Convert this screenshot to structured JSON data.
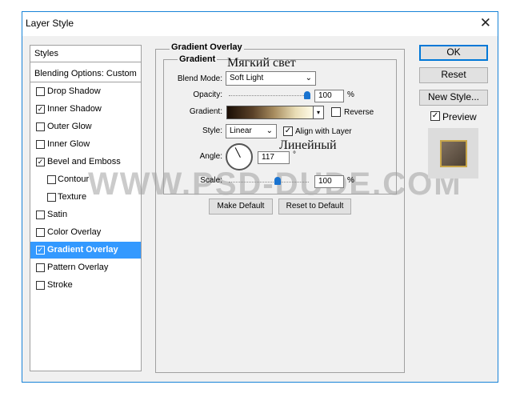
{
  "window": {
    "title": "Layer Style",
    "close_glyph": "✕"
  },
  "left_panel": {
    "styles_header": "Styles",
    "blending_options": "Blending Options: Custom",
    "items": [
      {
        "label": "Drop Shadow",
        "checked": false
      },
      {
        "label": "Inner Shadow",
        "checked": true
      },
      {
        "label": "Outer Glow",
        "checked": false
      },
      {
        "label": "Inner Glow",
        "checked": false
      },
      {
        "label": "Bevel and Emboss",
        "checked": true
      },
      {
        "label": "Contour",
        "checked": false
      },
      {
        "label": "Texture",
        "checked": false
      },
      {
        "label": "Satin",
        "checked": false
      },
      {
        "label": "Color Overlay",
        "checked": false
      },
      {
        "label": "Gradient Overlay",
        "checked": true,
        "selected": true
      },
      {
        "label": "Pattern Overlay",
        "checked": false
      },
      {
        "label": "Stroke",
        "checked": false
      }
    ]
  },
  "gradient_overlay": {
    "section_title": "Gradient Overlay",
    "group_title": "Gradient",
    "blend_mode_label": "Blend Mode:",
    "blend_mode_value": "Soft Light",
    "opacity_label": "Opacity:",
    "opacity_value": "100",
    "opacity_unit": "%",
    "gradient_label": "Gradient:",
    "reverse_label": "Reverse",
    "style_label": "Style:",
    "style_value": "Linear",
    "align_label": "Align with Layer",
    "angle_label": "Angle:",
    "angle_value": "117",
    "angle_unit": "°",
    "scale_label": "Scale:",
    "scale_value": "100",
    "scale_unit": "%",
    "make_default": "Make Default",
    "reset_default": "Reset to Default"
  },
  "annotations": {
    "soft_light_ru": "Мягкий свет",
    "linear_ru": "Линейный",
    "watermark": "WWW.PSD-DUDE.COM"
  },
  "buttons": {
    "ok": "OK",
    "reset": "Reset",
    "new_style": "New Style...",
    "preview": "Preview",
    "preview_checked": true
  },
  "icons": {
    "checkmark": "✓",
    "dropdown": "⌄"
  },
  "colors": {
    "selection": "#3399ff",
    "border_accent": "#1883d7"
  }
}
